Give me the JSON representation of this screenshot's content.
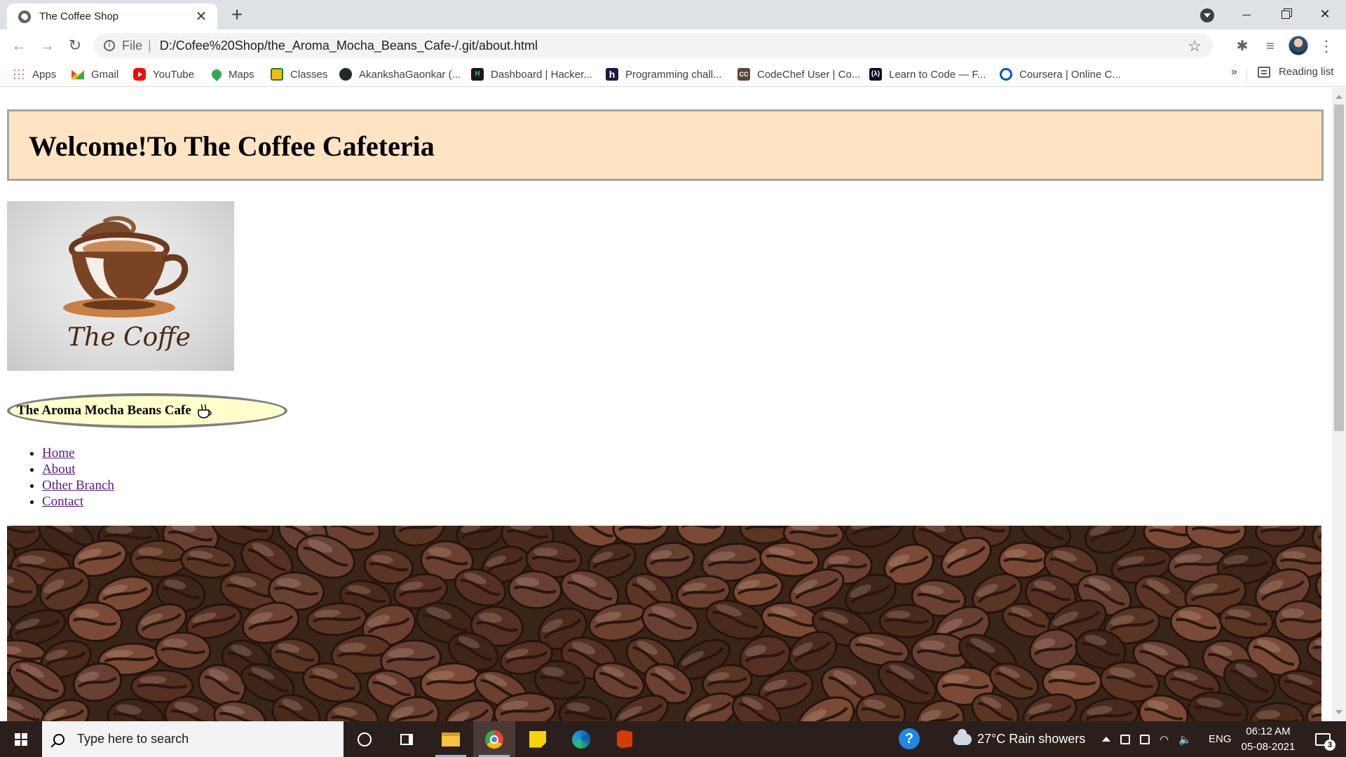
{
  "browser": {
    "tab_title": "The Coffee Shop",
    "new_tab_symbol": "+",
    "url_scheme": "File",
    "url": "D:/Cofee%20Shop/the_Aroma_Mocha_Beans_Cafe-/.git/about.html"
  },
  "bookmarks": [
    {
      "label": "Apps",
      "icon": "apps-grid-icon"
    },
    {
      "label": "Gmail",
      "icon": "gmail-icon"
    },
    {
      "label": "YouTube",
      "icon": "youtube-icon"
    },
    {
      "label": "Maps",
      "icon": "maps-icon"
    },
    {
      "label": "Classes",
      "icon": "classroom-icon"
    },
    {
      "label": "AkankshaGaonkar (...",
      "icon": "github-icon"
    },
    {
      "label": "Dashboard | Hacker...",
      "icon": "hackerrank-icon"
    },
    {
      "label": "Programming chall...",
      "icon": "hackerearth-icon"
    },
    {
      "label": "CodeChef User | Co...",
      "icon": "codechef-icon"
    },
    {
      "label": "Learn to Code — F...",
      "icon": "freecodecamp-icon"
    },
    {
      "label": "Coursera | Online C...",
      "icon": "coursera-icon"
    }
  ],
  "bookmarks_more": "»",
  "reading_list": "Reading list",
  "page": {
    "heading": "Welcome!To The Coffee Cafeteria",
    "logo_text": "The Coffe",
    "brand_name": "The Aroma Mocha Beans Cafe",
    "nav": [
      "Home",
      "About",
      "Other Branch",
      "Contact"
    ]
  },
  "taskbar": {
    "search_placeholder": "Type here to search",
    "weather": "27°C  Rain showers",
    "language": "ENG",
    "time": "06:12 AM",
    "date": "05-08-2021",
    "notification_count": "3"
  },
  "colors": {
    "header_bg": "#ffe4c4",
    "oval_bg": "#ffffcc",
    "link_visited": "#551a8b",
    "taskbar_bg": "#2b1f1c"
  }
}
